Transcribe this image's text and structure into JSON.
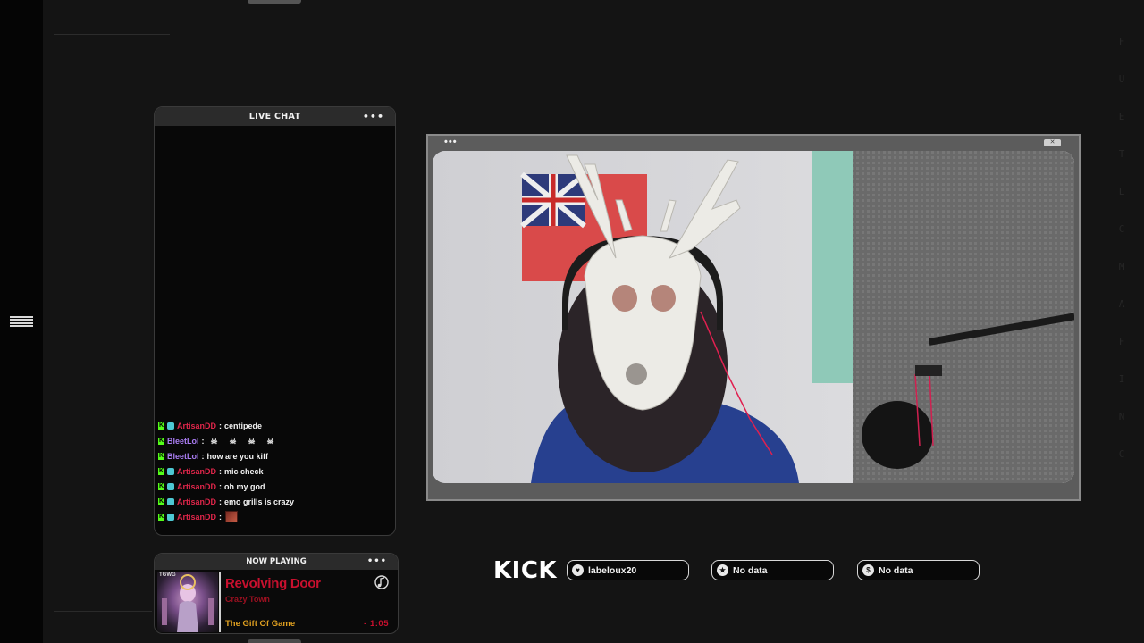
{
  "chat": {
    "title": "LIVE CHAT",
    "menu": "•••",
    "messages": [
      {
        "user": "ArtisanDD",
        "separator": ":",
        "text": "centipede",
        "color": "red",
        "emotes": 0,
        "image": false
      },
      {
        "user": "BleetLol",
        "separator": ":",
        "text": "",
        "color": "purple",
        "emotes": 4,
        "image": false
      },
      {
        "user": "BleetLol",
        "separator": ":",
        "text": "how are you kiff",
        "color": "purple",
        "emotes": 0,
        "image": false
      },
      {
        "user": "ArtisanDD",
        "separator": ":",
        "text": "mic check",
        "color": "red",
        "emotes": 0,
        "image": false
      },
      {
        "user": "ArtisanDD",
        "separator": ":",
        "text": "oh my god",
        "color": "red",
        "emotes": 0,
        "image": false
      },
      {
        "user": "ArtisanDD",
        "separator": ":",
        "text": "emo grills is crazy",
        "color": "red",
        "emotes": 0,
        "image": false
      },
      {
        "user": "ArtisanDD",
        "separator": ":",
        "text": "",
        "color": "red",
        "emotes": 0,
        "image": true
      }
    ]
  },
  "now_playing": {
    "title": "NOW PLAYING",
    "menu": "•••",
    "art_label": "TGWG",
    "song": "Revolving Door",
    "artist": "Crazy Town",
    "album": "The Gift Of Game",
    "time": "- 1:05"
  },
  "video": {
    "menu": "•••",
    "close": "✕"
  },
  "stats": {
    "platform": "KICK",
    "items": [
      {
        "icon": "heart-icon",
        "glyph": "♥",
        "label": "labeloux20"
      },
      {
        "icon": "star-icon",
        "glyph": "★",
        "label": "No data"
      },
      {
        "icon": "dollar-icon",
        "glyph": "$",
        "label": "No data"
      }
    ]
  },
  "decor": {
    "side_letters": [
      "F",
      "U",
      "E",
      "T",
      "L",
      "C",
      "M",
      "A",
      "F",
      "I",
      "N",
      "C"
    ]
  },
  "colors": {
    "kick_green": "#53fc18",
    "chat_red": "#e0264a",
    "chat_purple": "#a97cf2",
    "song_red": "#c8102e",
    "album_gold": "#e0a020"
  }
}
